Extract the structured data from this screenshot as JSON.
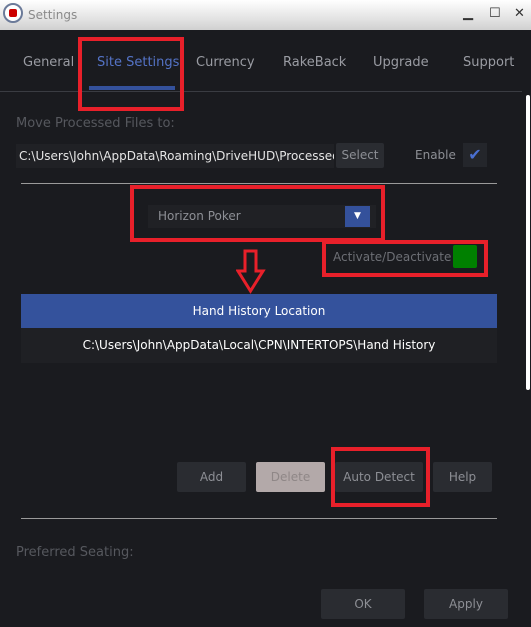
{
  "window": {
    "title": "Settings",
    "minimize": "▁",
    "maximize": "☐",
    "close": "✕"
  },
  "tabs": [
    "General",
    "Site Settings",
    "Currency",
    "RakeBack",
    "Upgrade",
    "Support"
  ],
  "move_processed": {
    "label": "Move Processed Files to:",
    "path": "C:\\Users\\John\\AppData\\Roaming\\DriveHUD\\ProcessedData",
    "select": "Select",
    "enable": "Enable",
    "enabled": true
  },
  "site": {
    "selected": "Horizon Poker",
    "activate_label": "Activate/Deactivate",
    "active": true,
    "active_color": "#008000"
  },
  "table": {
    "header": "Hand History Location",
    "rows": [
      "C:\\Users\\John\\AppData\\Local\\CPN\\INTERTOPS\\Hand History"
    ]
  },
  "buttons": {
    "add": "Add",
    "delete": "Delete",
    "auto_detect": "Auto Detect",
    "help": "Help",
    "ok": "OK",
    "apply": "Apply"
  },
  "preferred_seating": "Preferred Seating:",
  "colors": {
    "accent": "#34519b",
    "highlight": "#e8202a"
  }
}
